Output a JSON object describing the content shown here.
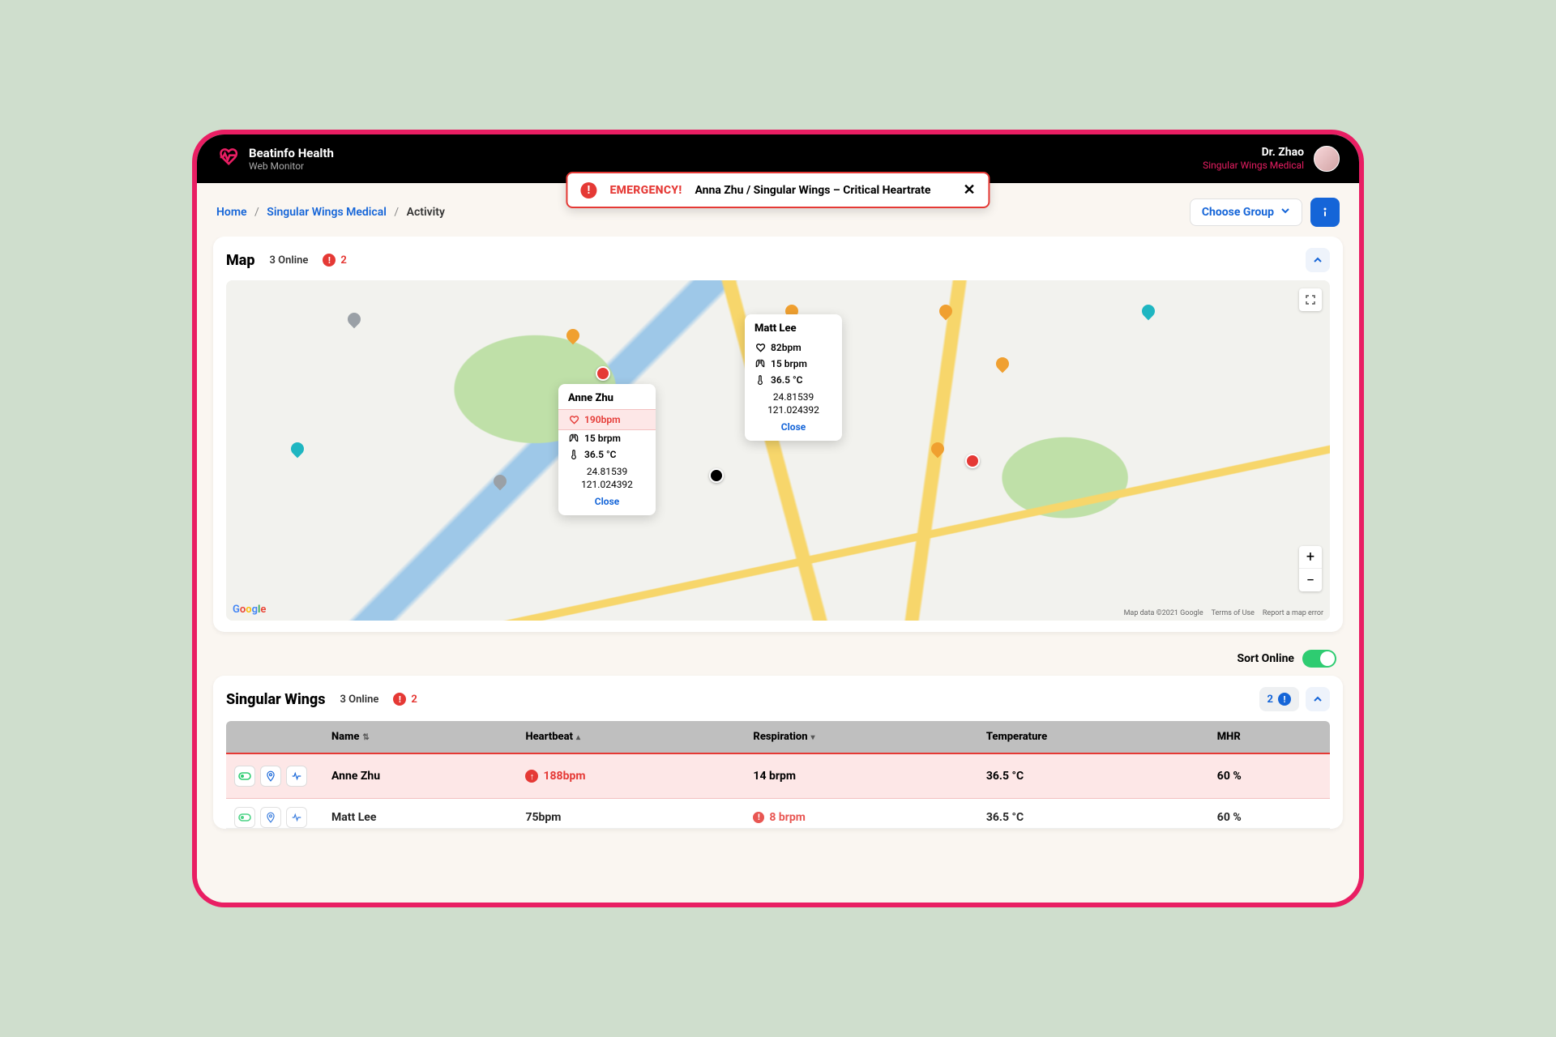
{
  "header": {
    "brand_title": "Beatinfo Health",
    "brand_sub": "Web Monitor",
    "user_name": "Dr. Zhao",
    "user_org": "Singular Wings Medical"
  },
  "alert": {
    "label": "EMERGENCY!",
    "text": "Anna Zhu / Singular Wings – Critical Heartrate"
  },
  "breadcrumb": {
    "home": "Home",
    "org": "Singular Wings Medical",
    "current": "Activity",
    "choose_group": "Choose Group"
  },
  "map_card": {
    "title": "Map",
    "online": "3 Online",
    "alerts": "2"
  },
  "map_footer": {
    "data": "Map data ©2021 Google",
    "terms": "Terms of Use",
    "report": "Report a map error"
  },
  "popup_anne": {
    "name": "Anne Zhu",
    "hr": "190bpm",
    "resp": "15 brpm",
    "temp": "36.5 °C",
    "lat": "24.81539",
    "lon": "121.024392",
    "close": "Close"
  },
  "popup_matt": {
    "name": "Matt Lee",
    "hr": "82bpm",
    "resp": "15 brpm",
    "temp": "36.5 °C",
    "lat": "24.81539",
    "lon": "121.024392",
    "close": "Close"
  },
  "sort": {
    "label": "Sort Online"
  },
  "table_card": {
    "title": "Singular Wings",
    "online": "3 Online",
    "alerts": "2",
    "badge_count": "2"
  },
  "columns": {
    "name": "Name",
    "heartbeat": "Heartbeat",
    "respiration": "Respiration",
    "temperature": "Temperature",
    "mhr": "MHR"
  },
  "rows": [
    {
      "name": "Anne Zhu",
      "hb": "188bpm",
      "resp": "14 brpm",
      "temp": "36.5 °C",
      "mhr": "60 %",
      "hb_alert": true,
      "resp_alert": false,
      "row_alert": true
    },
    {
      "name": "Matt Lee",
      "hb": "75bpm",
      "resp": "8 brpm",
      "temp": "36.5 °C",
      "mhr": "60 %",
      "hb_alert": false,
      "resp_alert": true,
      "row_alert": false
    }
  ]
}
